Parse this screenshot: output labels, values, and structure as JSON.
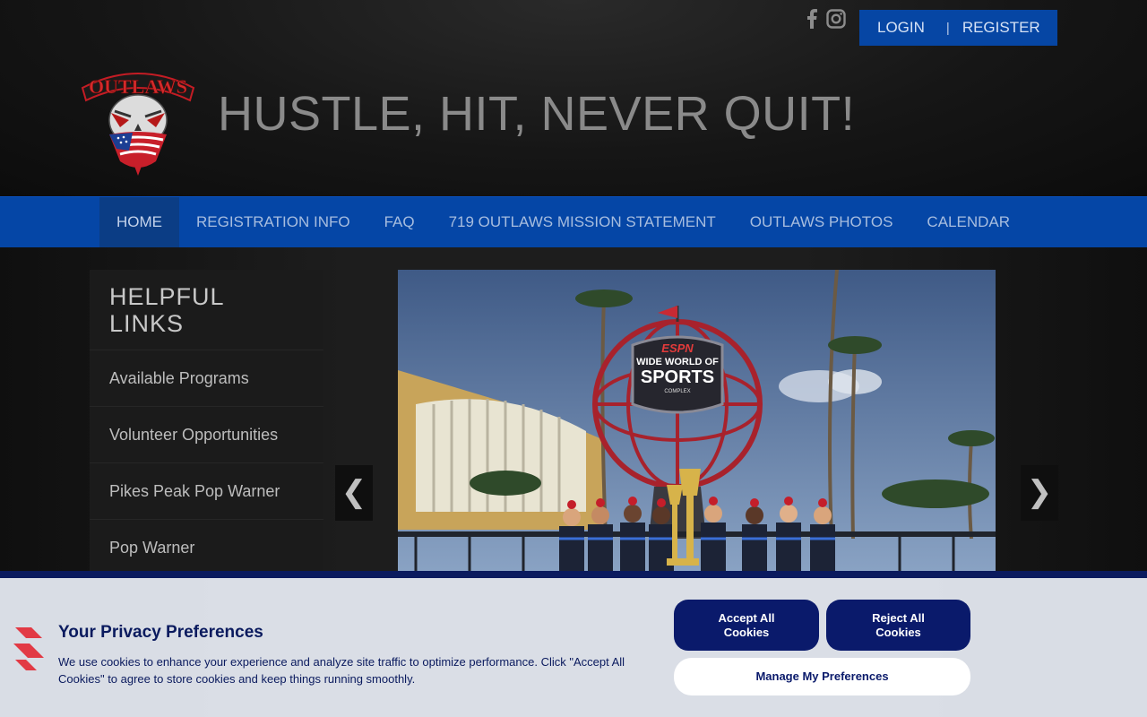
{
  "header": {
    "tagline": "HUSTLE, HIT, NEVER QUIT!",
    "logo_text": "OUTLAWS",
    "login_label": "LOGIN",
    "separator": "|",
    "register_label": "REGISTER",
    "social_icons": [
      "facebook-icon",
      "instagram-icon"
    ]
  },
  "nav": {
    "items": [
      {
        "label": "HOME",
        "active": true
      },
      {
        "label": "REGISTRATION INFO"
      },
      {
        "label": "FAQ"
      },
      {
        "label": "719 OUTLAWS MISSION STATEMENT"
      },
      {
        "label": "OUTLAWS PHOTOS"
      },
      {
        "label": "CALENDAR"
      }
    ]
  },
  "sidebar": {
    "title": "HELPFUL LINKS",
    "links": [
      {
        "label": "Available Programs"
      },
      {
        "label": "Volunteer Opportunities"
      },
      {
        "label": "Pikes Peak Pop Warner"
      },
      {
        "label": "Pop Warner"
      }
    ]
  },
  "slider": {
    "prev_glyph": "❮",
    "next_glyph": "❯",
    "globe_sign": {
      "line1": "ESPN",
      "line2": "WIDE WORLD OF",
      "line3": "SPORTS",
      "line4": "COMPLEX"
    }
  },
  "cookie": {
    "title": "Your Privacy Preferences",
    "text": "We use cookies to enhance your experience and analyze site traffic to optimize performance. Click \"Accept All Cookies\" to agree to store cookies and keep things running smoothly.",
    "accept_line1": "Accept All",
    "accept_line2": "Cookies",
    "reject_line1": "Reject All",
    "reject_line2": "Cookies",
    "manage_label": "Manage My Preferences"
  },
  "colors": {
    "brand_blue": "#0546a6",
    "nav_active": "#0b3d85",
    "cookie_navy": "#0a1a6b",
    "cookie_accent": "#e23a45"
  }
}
